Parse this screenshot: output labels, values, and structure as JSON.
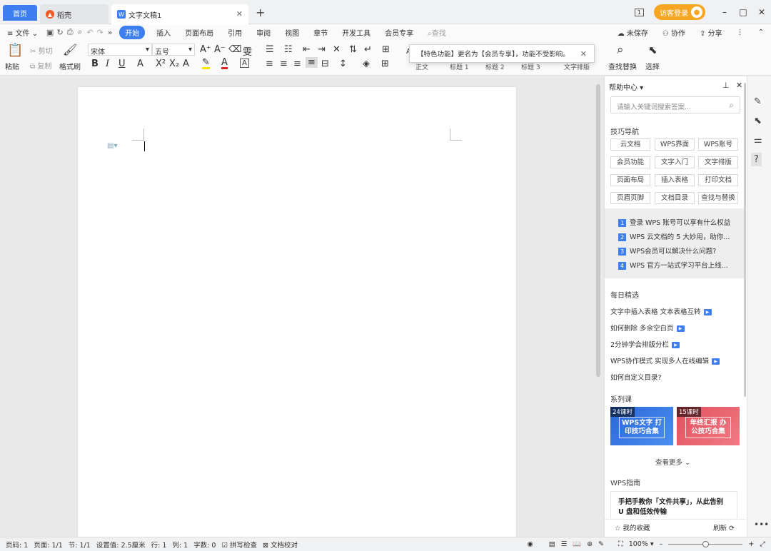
{
  "tabs": {
    "home": "首页",
    "daoke": "稻壳",
    "doc": "文字文稿1",
    "new_tab": "+"
  },
  "titlebar": {
    "guest_login": "访客登录",
    "page_indicator": "1"
  },
  "menu": {
    "file": "文件",
    "items": [
      "开始",
      "插入",
      "页面布局",
      "引用",
      "审阅",
      "视图",
      "章节",
      "开发工具",
      "会员专享"
    ],
    "search": "查找",
    "unsaved": "未保存",
    "collab": "协作",
    "share": "分享"
  },
  "ribbon": {
    "paste": "粘贴",
    "cut": "剪切",
    "copy": "复制",
    "format_painter": "格式刷",
    "font": "宋体",
    "size": "五号",
    "find_replace": "查找替换",
    "select": "选择",
    "style_normal": "正文",
    "h1": "标题 1",
    "h2": "标题 2",
    "h3": "标题 3",
    "text_layout": "文字排版"
  },
  "tooltip": {
    "text": "【特色功能】更名为【会员专享】，功能不受影响。"
  },
  "help": {
    "title": "帮助中心",
    "search_placeholder": "请输入关键词搜索答案...",
    "nav_title": "技巧导航",
    "chips": [
      "云文档",
      "WPS界面",
      "WPS账号",
      "会员功能",
      "文字入门",
      "文字排版",
      "页面布局",
      "插入表格",
      "打印文档",
      "页眉页脚",
      "文档目录",
      "查找与替换"
    ],
    "faq": [
      {
        "num": "1",
        "text": "登录 WPS 账号可以享有什么权益"
      },
      {
        "num": "2",
        "text": "WPS 云文档的 5 大妙用，助你..."
      },
      {
        "num": "3",
        "text": "WPS会员可以解决什么问题?"
      },
      {
        "num": "4",
        "text": "WPS 官方一站式学习平台上线..."
      }
    ],
    "daily_title": "每日精选",
    "daily": [
      "文字中插入表格 文本表格互转",
      "如何删除 多余空白页",
      "2分钟学会排版分栏",
      "WPS协作模式 实现多人在线编辑",
      "如何自定义目录?"
    ],
    "series_title": "系列课",
    "courses": [
      {
        "tag": "24课时",
        "title": "WPS文字 打印技巧合集",
        "color": "#3f7fe0"
      },
      {
        "tag": "15课时",
        "title": "年终汇报 办公技巧合集",
        "color": "#e8606a"
      }
    ],
    "more": "查看更多",
    "guide_title": "WPS指南",
    "guide_card": "手把手教你「文件共享」，从此告别 U 盘和低效传输",
    "favorites": "我的收藏",
    "refresh": "刷新"
  },
  "status": {
    "page_no": "页码: 1",
    "pages": "页面: 1/1",
    "section": "节: 1/1",
    "setting": "设置值: 2.5厘米",
    "row": "行: 1",
    "col": "列: 1",
    "words": "字数: 0",
    "spell": "拼写检查",
    "proof": "文档校对",
    "zoom": "100%"
  },
  "colors": {
    "accent": "#3d7ff0",
    "guest": "#f6a623"
  }
}
